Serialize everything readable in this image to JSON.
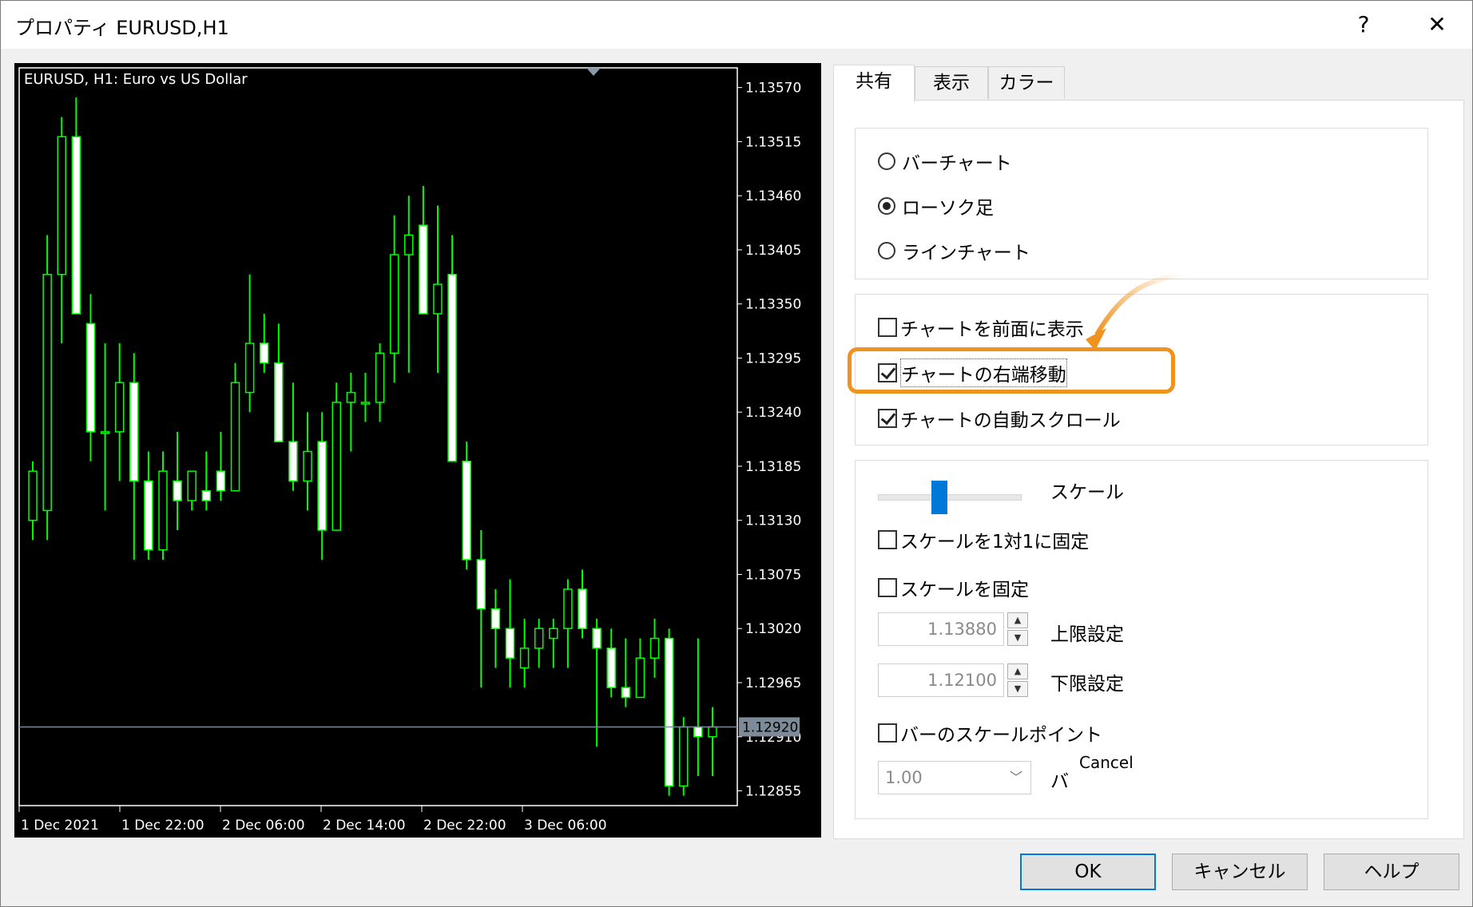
{
  "window": {
    "title": "プロパティ EURUSD,H1",
    "help_glyph": "?",
    "close_glyph": "✕"
  },
  "chart": {
    "header": "EURUSD, H1:  Euro vs US Dollar",
    "bid_label": "1.12920",
    "bid_line_color": "#7d8a97",
    "bull_color": "#00ff00",
    "bear_color": "#00ff00",
    "bull_body_fill": "#000000",
    "bear_body_fill": "#ffffff",
    "background": "#000000",
    "axis_color": "#ffffff"
  },
  "chart_data": {
    "type": "candlestick",
    "symbol": "EURUSD",
    "timeframe": "H1",
    "ylim": [
      1.1284,
      1.1359
    ],
    "y_ticks": [
      "1.13570",
      "1.13515",
      "1.13460",
      "1.13405",
      "1.13350",
      "1.13295",
      "1.13240",
      "1.13185",
      "1.13130",
      "1.13075",
      "1.13020",
      "1.12965",
      "1.12910",
      "1.12855"
    ],
    "x_ticks": [
      "1 Dec 2021",
      "1 Dec 22:00",
      "2 Dec 06:00",
      "2 Dec 14:00",
      "2 Dec 22:00",
      "3 Dec 06:00"
    ],
    "current_price": 1.1292,
    "candles": [
      {
        "o": 1.1313,
        "h": 1.1319,
        "l": 1.1311,
        "c": 1.1318
      },
      {
        "o": 1.1314,
        "h": 1.1342,
        "l": 1.1311,
        "c": 1.1338
      },
      {
        "o": 1.1338,
        "h": 1.1354,
        "l": 1.1331,
        "c": 1.1352
      },
      {
        "o": 1.1352,
        "h": 1.1356,
        "l": 1.1334,
        "c": 1.1334
      },
      {
        "o": 1.1333,
        "h": 1.1336,
        "l": 1.1319,
        "c": 1.1322
      },
      {
        "o": 1.1322,
        "h": 1.1331,
        "l": 1.1314,
        "c": 1.1322
      },
      {
        "o": 1.1322,
        "h": 1.1331,
        "l": 1.1317,
        "c": 1.1327
      },
      {
        "o": 1.1327,
        "h": 1.133,
        "l": 1.1309,
        "c": 1.1317
      },
      {
        "o": 1.1317,
        "h": 1.132,
        "l": 1.1309,
        "c": 1.131
      },
      {
        "o": 1.131,
        "h": 1.132,
        "l": 1.1309,
        "c": 1.1318
      },
      {
        "o": 1.1317,
        "h": 1.1322,
        "l": 1.1312,
        "c": 1.1315
      },
      {
        "o": 1.1315,
        "h": 1.1318,
        "l": 1.1314,
        "c": 1.1318
      },
      {
        "o": 1.1316,
        "h": 1.132,
        "l": 1.1314,
        "c": 1.1315
      },
      {
        "o": 1.1318,
        "h": 1.1322,
        "l": 1.1315,
        "c": 1.1316
      },
      {
        "o": 1.1316,
        "h": 1.1329,
        "l": 1.1316,
        "c": 1.1327
      },
      {
        "o": 1.1326,
        "h": 1.1338,
        "l": 1.1324,
        "c": 1.1331
      },
      {
        "o": 1.1331,
        "h": 1.1334,
        "l": 1.1328,
        "c": 1.1329
      },
      {
        "o": 1.1329,
        "h": 1.1333,
        "l": 1.1322,
        "c": 1.1321
      },
      {
        "o": 1.1321,
        "h": 1.1327,
        "l": 1.1316,
        "c": 1.1317
      },
      {
        "o": 1.1317,
        "h": 1.1324,
        "l": 1.1314,
        "c": 1.132
      },
      {
        "o": 1.1321,
        "h": 1.1324,
        "l": 1.1309,
        "c": 1.1312
      },
      {
        "o": 1.1312,
        "h": 1.1327,
        "l": 1.1312,
        "c": 1.1325
      },
      {
        "o": 1.1325,
        "h": 1.1328,
        "l": 1.132,
        "c": 1.1326
      },
      {
        "o": 1.1325,
        "h": 1.1328,
        "l": 1.1323,
        "c": 1.1325
      },
      {
        "o": 1.1325,
        "h": 1.1331,
        "l": 1.1323,
        "c": 1.133
      },
      {
        "o": 1.133,
        "h": 1.1344,
        "l": 1.1327,
        "c": 1.134
      },
      {
        "o": 1.134,
        "h": 1.1346,
        "l": 1.1328,
        "c": 1.1342
      },
      {
        "o": 1.1343,
        "h": 1.1347,
        "l": 1.1334,
        "c": 1.1334
      },
      {
        "o": 1.1334,
        "h": 1.1345,
        "l": 1.1328,
        "c": 1.1337
      },
      {
        "o": 1.1338,
        "h": 1.1342,
        "l": 1.1319,
        "c": 1.1319
      },
      {
        "o": 1.1319,
        "h": 1.1321,
        "l": 1.1308,
        "c": 1.1309
      },
      {
        "o": 1.1309,
        "h": 1.1312,
        "l": 1.1296,
        "c": 1.1304
      },
      {
        "o": 1.1304,
        "h": 1.1306,
        "l": 1.1298,
        "c": 1.1302
      },
      {
        "o": 1.1302,
        "h": 1.1307,
        "l": 1.1296,
        "c": 1.1299
      },
      {
        "o": 1.1298,
        "h": 1.1303,
        "l": 1.1296,
        "c": 1.13
      },
      {
        "o": 1.13,
        "h": 1.1303,
        "l": 1.1298,
        "c": 1.1302
      },
      {
        "o": 1.1301,
        "h": 1.1303,
        "l": 1.1298,
        "c": 1.1302
      },
      {
        "o": 1.1302,
        "h": 1.1307,
        "l": 1.1298,
        "c": 1.1306
      },
      {
        "o": 1.1306,
        "h": 1.1308,
        "l": 1.1301,
        "c": 1.1302
      },
      {
        "o": 1.1302,
        "h": 1.1303,
        "l": 1.129,
        "c": 1.13
      },
      {
        "o": 1.13,
        "h": 1.1302,
        "l": 1.1295,
        "c": 1.1296
      },
      {
        "o": 1.1296,
        "h": 1.1301,
        "l": 1.1294,
        "c": 1.1295
      },
      {
        "o": 1.1295,
        "h": 1.1301,
        "l": 1.1295,
        "c": 1.1299
      },
      {
        "o": 1.1299,
        "h": 1.1303,
        "l": 1.1297,
        "c": 1.1301
      },
      {
        "o": 1.1301,
        "h": 1.1302,
        "l": 1.1285,
        "c": 1.1286
      },
      {
        "o": 1.1286,
        "h": 1.1293,
        "l": 1.1285,
        "c": 1.1292
      },
      {
        "o": 1.1292,
        "h": 1.1301,
        "l": 1.1287,
        "c": 1.1291
      },
      {
        "o": 1.1291,
        "h": 1.1294,
        "l": 1.1287,
        "c": 1.1292
      }
    ]
  },
  "tabs": [
    "共有",
    "表示",
    "カラー"
  ],
  "chart_type": {
    "options": [
      "バーチャート",
      "ローソク足",
      "ラインチャート"
    ],
    "selected_index": 1
  },
  "flags": [
    {
      "label": "チャートを前面に表示",
      "checked": false
    },
    {
      "label": "チャートの右端移動",
      "checked": true
    },
    {
      "label": "チャートの自動スクロール",
      "checked": true
    }
  ],
  "scale": {
    "slider_label": "スケール",
    "fix_one_to_one": {
      "label": "スケールを1対1に固定",
      "checked": false
    },
    "fix_scale": {
      "label": "スケールを固定",
      "checked": false
    },
    "upper_value": "1.13880",
    "upper_label": "上限設定",
    "lower_value": "1.12100",
    "lower_label": "下限設定",
    "bar_scale_point": {
      "label": "バーのスケールポイント",
      "checked": false
    },
    "point_value": "1.00",
    "point_suffix": "バ",
    "overlay_text": "Cancel"
  },
  "buttons": {
    "ok": "OK",
    "cancel": "キャンセル",
    "help": "ヘルプ"
  },
  "annotation": {
    "highlight_color": "#f0921e"
  }
}
